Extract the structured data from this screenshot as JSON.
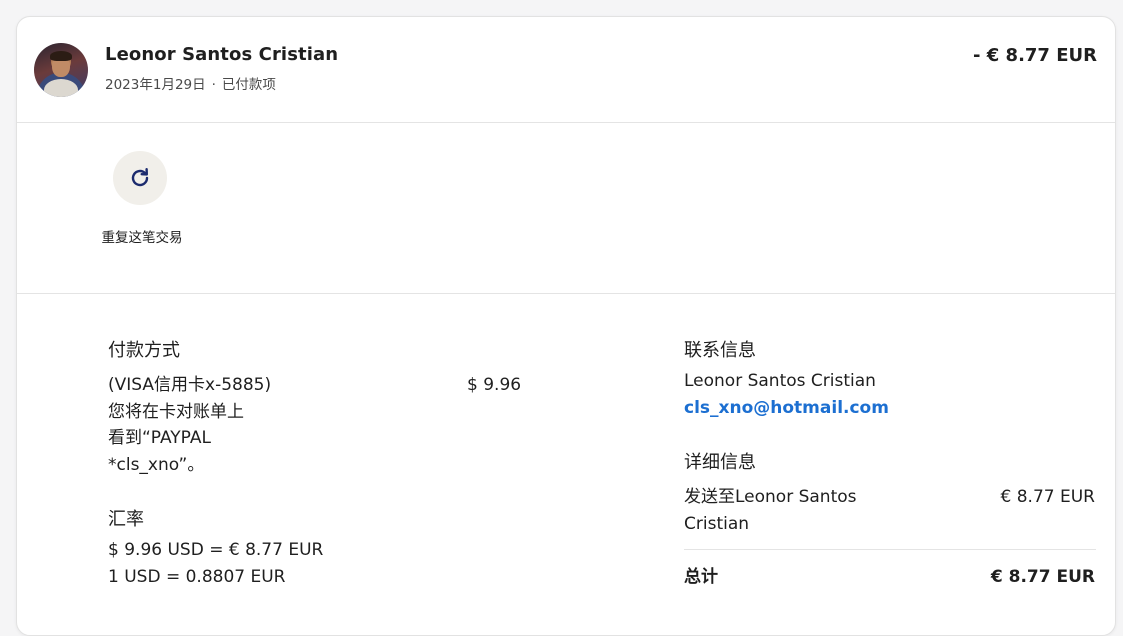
{
  "header": {
    "name": "Leonor Santos Cristian",
    "date": "2023年1月29日",
    "separator": "·",
    "status": "已付款项",
    "amount": "- € 8.77 EUR"
  },
  "actions": {
    "repeat_label": "重复这笔交易",
    "icon": "refresh-icon",
    "accent_color": "#1c2b6e"
  },
  "payment": {
    "title": "付款方式",
    "card_line1": "(VISA信用卡x-5885)",
    "card_line2": "您将在卡对账单上",
    "card_line3": "看到“PAYPAL",
    "card_line4": "*cls_xno”。",
    "amount": "$ 9.96"
  },
  "exchange": {
    "title": "汇率",
    "line1": "$ 9.96 USD = € 8.77 EUR",
    "line2": "1 USD = 0.8807 EUR"
  },
  "contact": {
    "title": "联系信息",
    "name": "Leonor Santos Cristian",
    "email": "cls_xno@hotmail.com",
    "link_color": "#1c6fd1"
  },
  "details": {
    "title": "详细信息",
    "sent_to_line1": "发送至Leonor Santos",
    "sent_to_line2": "Cristian",
    "sent_amount": "€ 8.77 EUR",
    "total_label": "总计",
    "total_amount": "€ 8.77 EUR"
  }
}
